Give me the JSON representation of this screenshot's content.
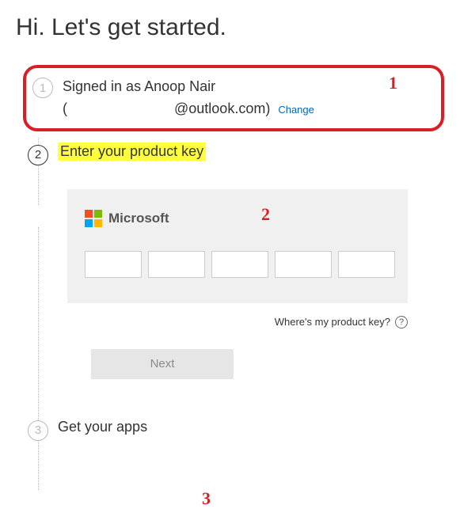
{
  "page": {
    "title": "Hi. Let's get started."
  },
  "annotations": {
    "a1": "1",
    "a2": "2",
    "a3": "3"
  },
  "step1": {
    "num": "1",
    "signed_in_prefix": "Signed in as ",
    "user_name": "Anoop Nair",
    "email_open": "(",
    "email_hidden": "",
    "email_domain": "@outlook.com)",
    "change_label": "Change"
  },
  "step2": {
    "num": "2",
    "title": "Enter your product key",
    "brand": "Microsoft",
    "wheres_key": "Where's my product key?",
    "help_glyph": "?",
    "next_label": "Next"
  },
  "step3": {
    "num": "3",
    "title": "Get your apps"
  }
}
